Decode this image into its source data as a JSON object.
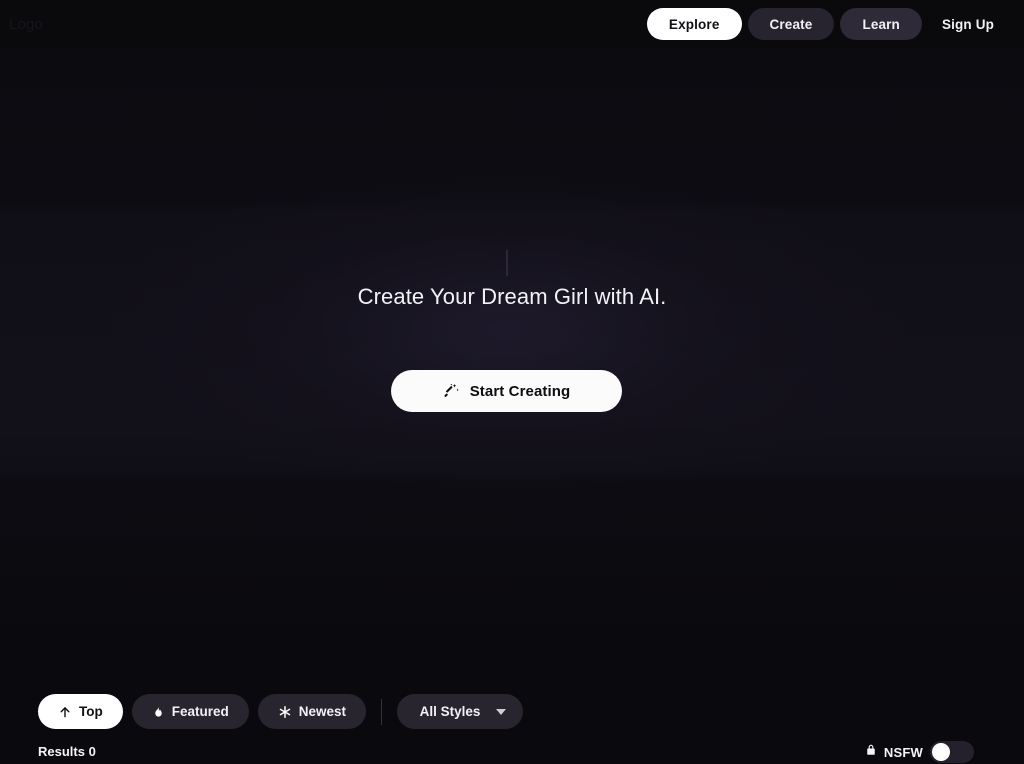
{
  "header": {
    "logo": "Logo",
    "nav": [
      {
        "label": "Explore",
        "state": "active",
        "icon": "none"
      },
      {
        "label": "Create",
        "state": "dim",
        "icon": "none"
      },
      {
        "label": "Learn",
        "state": "dim2",
        "icon": "none"
      },
      {
        "label": "Sign Up",
        "state": "plain",
        "icon": "none"
      }
    ]
  },
  "hero": {
    "title": "Create Your Dream Girl with AI.",
    "cta_label": "Start Creating",
    "cta_icon": "magic-wand-icon"
  },
  "filters": {
    "chips": [
      {
        "label": "Top",
        "icon": "arrow-up-icon",
        "state": "active"
      },
      {
        "label": "Featured",
        "icon": "flame-icon",
        "state": "idle"
      },
      {
        "label": "Newest",
        "icon": "sparkle-icon",
        "state": "idle"
      }
    ],
    "style_select": {
      "value": "All Styles",
      "icon": "chevron-down-icon"
    }
  },
  "results": {
    "label": "Results 0"
  },
  "nsfw": {
    "label": "NSFW",
    "icon": "lock-icon",
    "enabled": false
  },
  "colors": {
    "page_bg": "#0b0a0e",
    "header_bg": "#0a0a0d",
    "accent_white": "#ffffff",
    "chip_idle": "#29252f",
    "nav_dim": "#272430",
    "nav_dim2": "#2e2a38",
    "text_primary": "#f3f2f6",
    "logo_text": "#16151b"
  }
}
